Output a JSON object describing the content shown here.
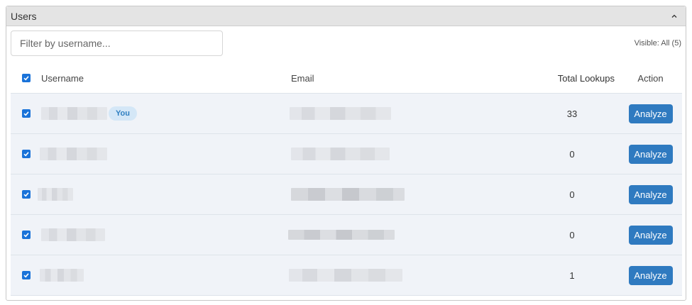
{
  "panel": {
    "title": "Users"
  },
  "filter": {
    "placeholder": "Filter by username..."
  },
  "visible_label": "Visible: All (5)",
  "table": {
    "columns": {
      "username": "Username",
      "email": "Email",
      "total": "Total Lookups",
      "action": "Action"
    },
    "rows": [
      {
        "badge": "You",
        "total": "33",
        "action": "Analyze"
      },
      {
        "badge": "",
        "total": "0",
        "action": "Analyze"
      },
      {
        "badge": "",
        "total": "0",
        "action": "Analyze"
      },
      {
        "badge": "",
        "total": "0",
        "action": "Analyze"
      },
      {
        "badge": "",
        "total": "1",
        "action": "Analyze"
      }
    ]
  },
  "colors": {
    "accent": "#2f7ac0",
    "checkbox": "#1a73d9",
    "row_bg": "#f0f3f8",
    "badge_bg": "#d4e7f7"
  },
  "icons": {
    "collapse": "chevron-up-icon",
    "check": "checkmark-icon"
  }
}
